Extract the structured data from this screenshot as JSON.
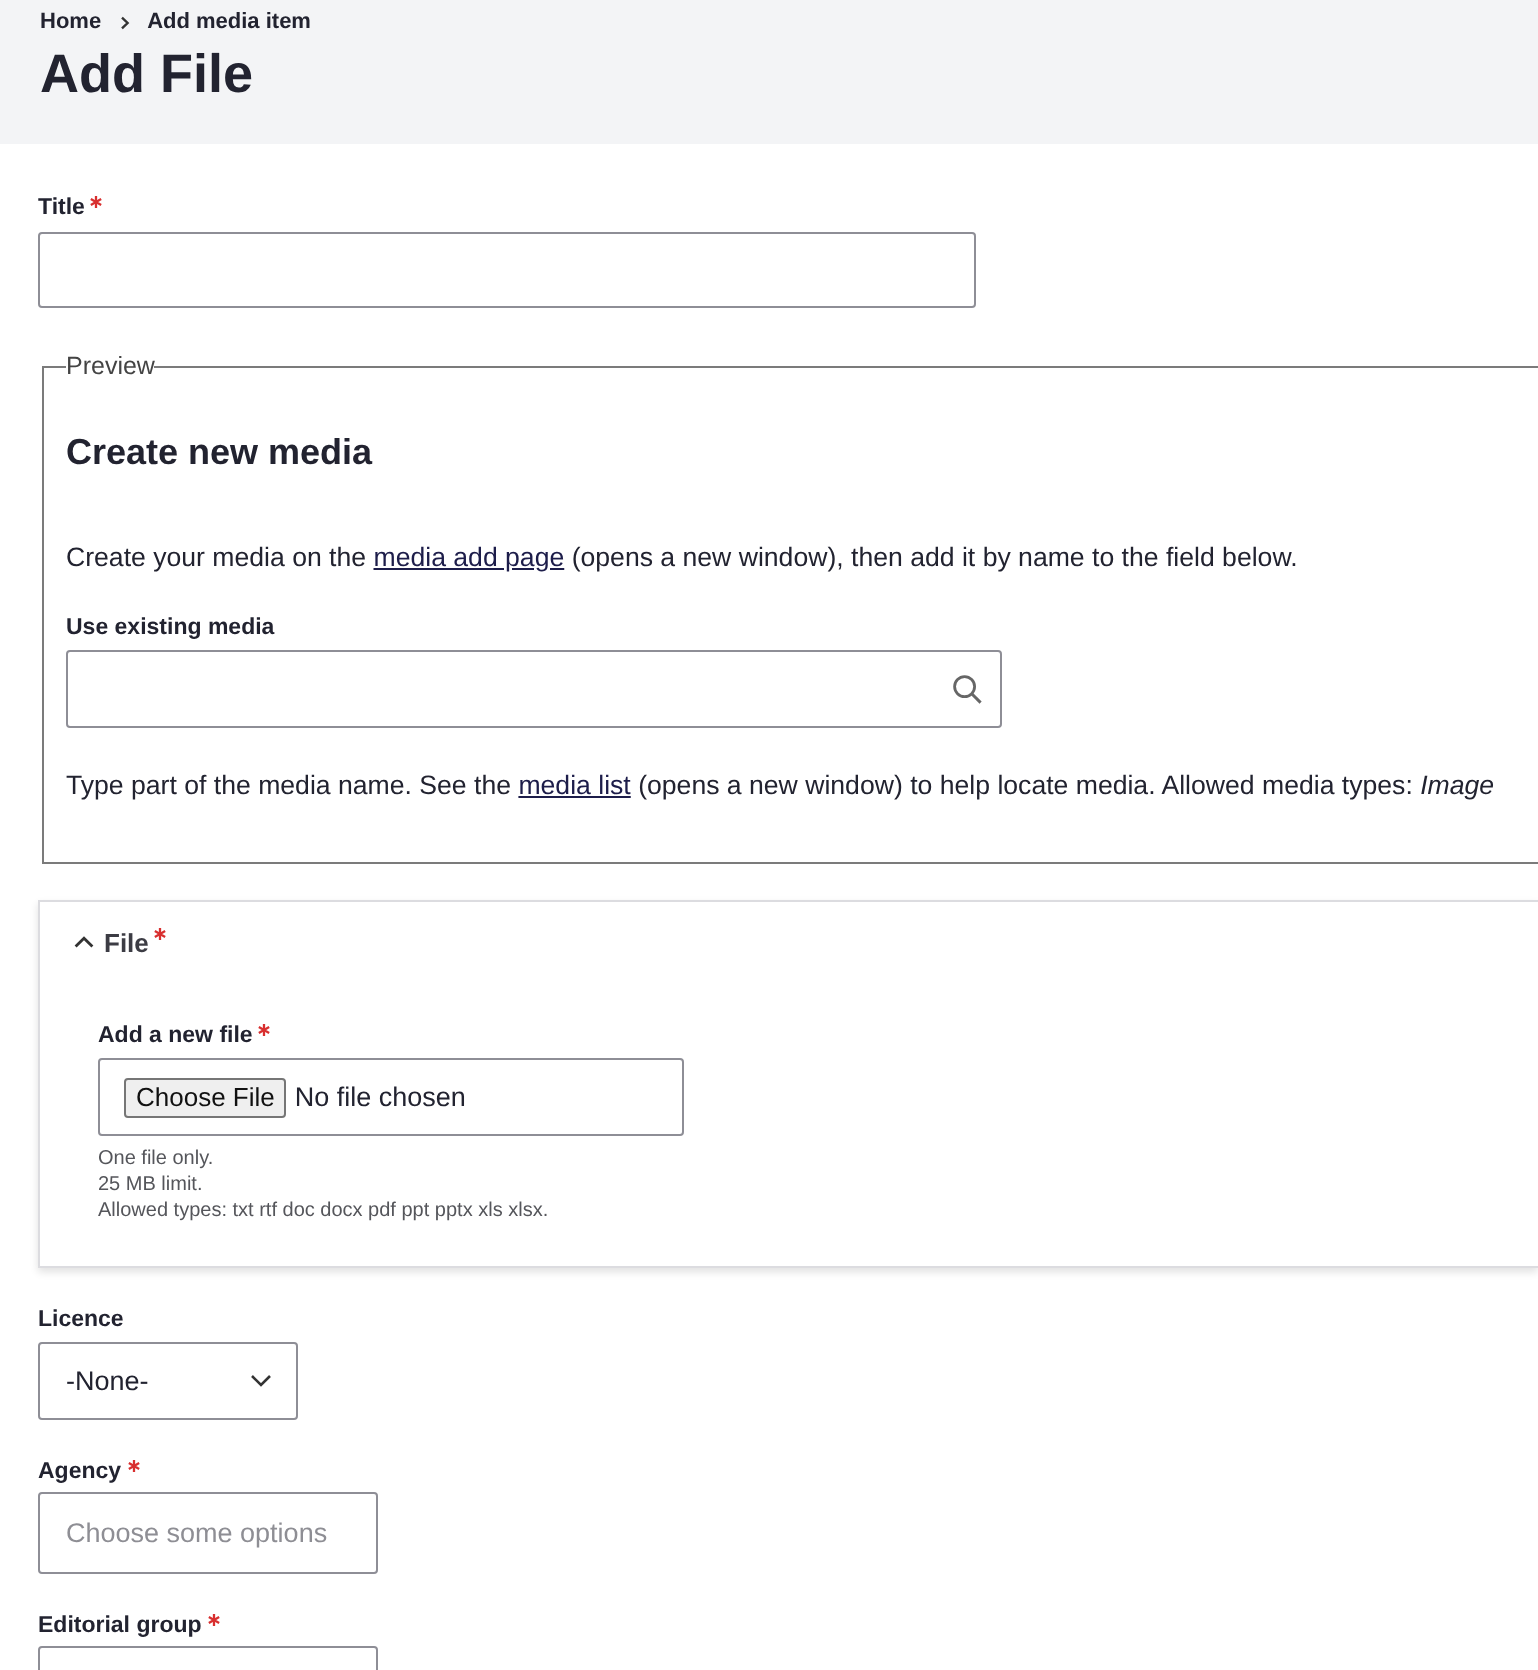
{
  "breadcrumb": [
    {
      "label": "Home"
    },
    {
      "label": "Add media item"
    }
  ],
  "page_title": "Add File",
  "title_field": {
    "label": "Title",
    "required": true
  },
  "preview": {
    "legend": "Preview",
    "heading": "Create new media",
    "intro": {
      "before": "Create your media on the",
      "link": "media add page",
      "after": "(opens a new window), then add it by name to the field below."
    },
    "search_field": {
      "label": "Use existing media"
    },
    "help": {
      "before": "Type part of the media name. See the",
      "link": "media list",
      "after": "(opens a new window) to help locate media. Allowed media types: *Image*"
    }
  },
  "file_section": {
    "summary": "File",
    "required": true,
    "expanded": true,
    "upload": {
      "label": "Add a new file",
      "required": true,
      "button": "Choose File",
      "status": "No file chosen"
    },
    "help_lines": [
      "One file only.",
      "25 MB limit.",
      "Allowed types: txt rtf doc docx pdf ppt pptx xls xlsx."
    ]
  },
  "fields": [
    {
      "kind": "select",
      "label": "Licence",
      "required": false,
      "value": "-None-"
    },
    {
      "kind": "multiselect",
      "label": "Agency",
      "required": true,
      "placeholder": "Choose some options"
    },
    {
      "kind": "text",
      "label": "Editorial group",
      "required": true
    }
  ]
}
